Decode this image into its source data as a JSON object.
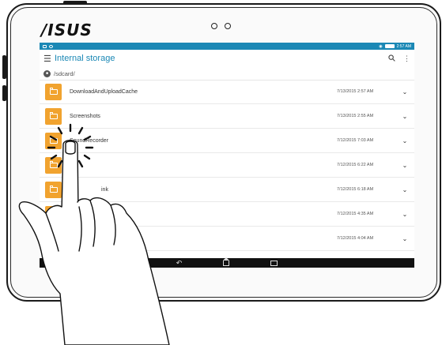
{
  "device": {
    "brand": "/ISUS"
  },
  "statusbar": {
    "time": "2:57 AM"
  },
  "appbar": {
    "menu_icon": "hamburger-icon",
    "title": "Internal storage",
    "search_icon": "search-icon",
    "overflow_icon": "more-vert-icon"
  },
  "path": {
    "icon": "sdcard-icon",
    "text": "/sdcard/"
  },
  "files": [
    {
      "name": "DownloadAndUploadCache",
      "date": "7/13/2015  2:57 AM"
    },
    {
      "name": "Screenshots",
      "date": "7/13/2015  2:55 AM"
    },
    {
      "name": "SoundRecorder",
      "date": "7/12/2015  7:03 AM"
    },
    {
      "name": "",
      "date": "7/12/2015  6:22 AM"
    },
    {
      "name": "ink",
      "date": "7/12/2015  6:18 AM"
    },
    {
      "name": "",
      "date": "7/12/2015  4:35 AM"
    },
    {
      "name": "",
      "date": "7/12/2015  4:04 AM"
    }
  ],
  "navbar": {
    "back_icon": "back-icon",
    "home_icon": "home-icon",
    "recent_icon": "recent-apps-icon"
  },
  "colors": {
    "accent": "#1b88b5",
    "folder": "#f1a32f"
  }
}
